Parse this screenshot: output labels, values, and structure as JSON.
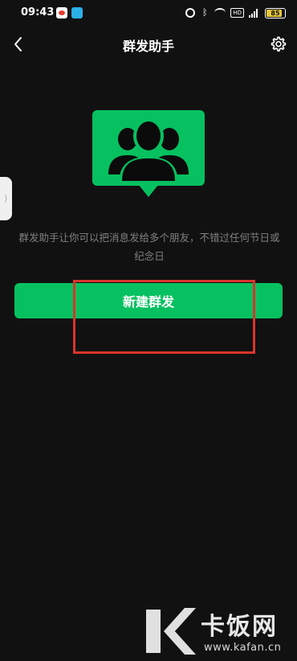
{
  "status_bar": {
    "time": "09:43",
    "app_badge": "lion",
    "hd_label": "HD",
    "network_label": "5G",
    "battery": "85"
  },
  "header": {
    "title": "群发助手"
  },
  "content": {
    "description": "群发助手让你可以把消息发给多个朋友，不错过任何节日或纪念日",
    "new_broadcast_label": "新建群发"
  },
  "watermark": {
    "name": "卡饭网",
    "url": "www.kafan.cn"
  },
  "colors": {
    "background": "#111111",
    "accent_green": "#07c160",
    "annotation_red": "#d9342b"
  },
  "icons": {
    "back": "chevron-left-icon",
    "settings": "gear-icon",
    "hero": "group-people-icon"
  }
}
